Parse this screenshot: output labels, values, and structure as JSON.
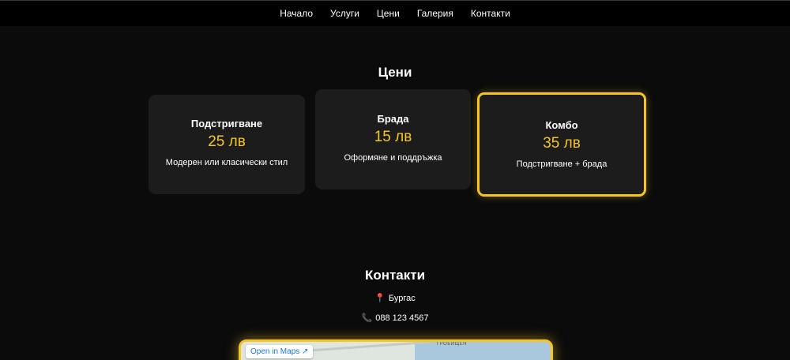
{
  "nav": {
    "items": [
      "Начало",
      "Услуги",
      "Цени",
      "Галерия",
      "Контакти"
    ]
  },
  "prices": {
    "title": "Цени",
    "cards": [
      {
        "name": "Подстригване",
        "price": "25 лв",
        "desc": "Модерен или класически стил"
      },
      {
        "name": "Брада",
        "price": "15 лв",
        "desc": "Оформяне и поддръжка"
      },
      {
        "name": "Комбо",
        "price": "35 лв",
        "desc": "Подстригване + брада"
      }
    ]
  },
  "contacts": {
    "title": "Контакти",
    "city": "Бургас",
    "phone": "088 123 4567",
    "map": {
      "open_label": "Open in Maps",
      "town_label": "ГРОБИЩЕН"
    }
  },
  "colors": {
    "accent": "#f6c521",
    "background": "#0b0b0b",
    "card": "#1c1c1c"
  }
}
